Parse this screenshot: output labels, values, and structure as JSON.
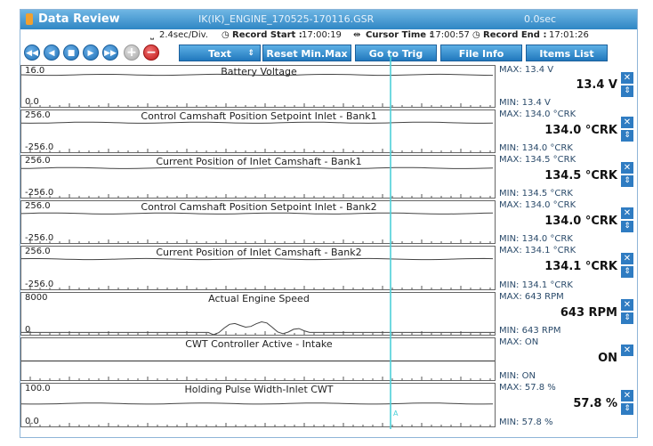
{
  "window": {
    "title": "Data Review",
    "file": "IK(IK)_ENGINE_170525-170116.GSR",
    "speed": "0.0sec"
  },
  "info": {
    "time_div": "2.4sec/Div.",
    "record_start_label": "Record Start :",
    "record_start": "17:00:19",
    "cursor_time_label": "Cursor Time :",
    "cursor_time": "17:00:57",
    "record_end_label": "Record End :",
    "record_end": "17:01:26"
  },
  "toolbar": {
    "nav": [
      "◀◀",
      "◀",
      "■",
      "▶",
      "▶▶"
    ],
    "zoom_in": "+",
    "zoom_out": "−",
    "text_select": "Text",
    "reset": "Reset Min.Max",
    "goto_trig": "Go to Trig",
    "file_info": "File Info",
    "items_list": "Items List"
  },
  "cursor_marker": "A",
  "panels": [
    {
      "title": "Battery Voltage",
      "ymax": "16.0",
      "ymin": "0.0",
      "max": "MAX:  13.4 V",
      "cur": "13.4  V",
      "min": "MIN:  13.4 V",
      "level": 0.84
    },
    {
      "title": "Control Camshaft Position Setpoint Inlet - Bank1",
      "ymax": "256.0",
      "ymin": "-256.0",
      "max": "MAX: 134.0 °CRK",
      "cur": "134.0  °CRK",
      "min": "MIN: 134.0 °CRK",
      "level": 0.76
    },
    {
      "title": "Current Position of Inlet Camshaft - Bank1",
      "ymax": "256.0",
      "ymin": "-256.0",
      "max": "MAX: 134.5 °CRK",
      "cur": "134.5  °CRK",
      "min": "MIN: 134.5 °CRK",
      "level": 0.76
    },
    {
      "title": "Control Camshaft Position Setpoint Inlet - Bank2",
      "ymax": "256.0",
      "ymin": "-256.0",
      "max": "MAX: 134.0 °CRK",
      "cur": "134.0  °CRK",
      "min": "MIN: 134.0 °CRK",
      "level": 0.76
    },
    {
      "title": "Current Position of Inlet Camshaft - Bank2",
      "ymax": "256.0",
      "ymin": "-256.0",
      "max": "MAX: 134.1 °CRK",
      "cur": "134.1  °CRK",
      "min": "MIN: 134.1 °CRK",
      "level": 0.76
    },
    {
      "title": "Actual Engine Speed",
      "ymax": "8000",
      "ymin": "0",
      "max": "MAX:    643 RPM",
      "cur": "643 RPM",
      "min": "MIN:    643 RPM",
      "level": 0.08
    },
    {
      "title": "CWT Controller Active - Intake",
      "ymax": "",
      "ymin": "",
      "max": "MAX: ON",
      "cur": "ON",
      "min": "MIN: ON",
      "level": 0.5
    },
    {
      "title": "Holding Pulse Width-Inlet CWT",
      "ymax": "100.0",
      "ymin": "0.0",
      "max": "MAX:  57.8 %",
      "cur": "57.8  %",
      "min": "MIN:  57.8 %",
      "level": 0.58
    }
  ]
}
